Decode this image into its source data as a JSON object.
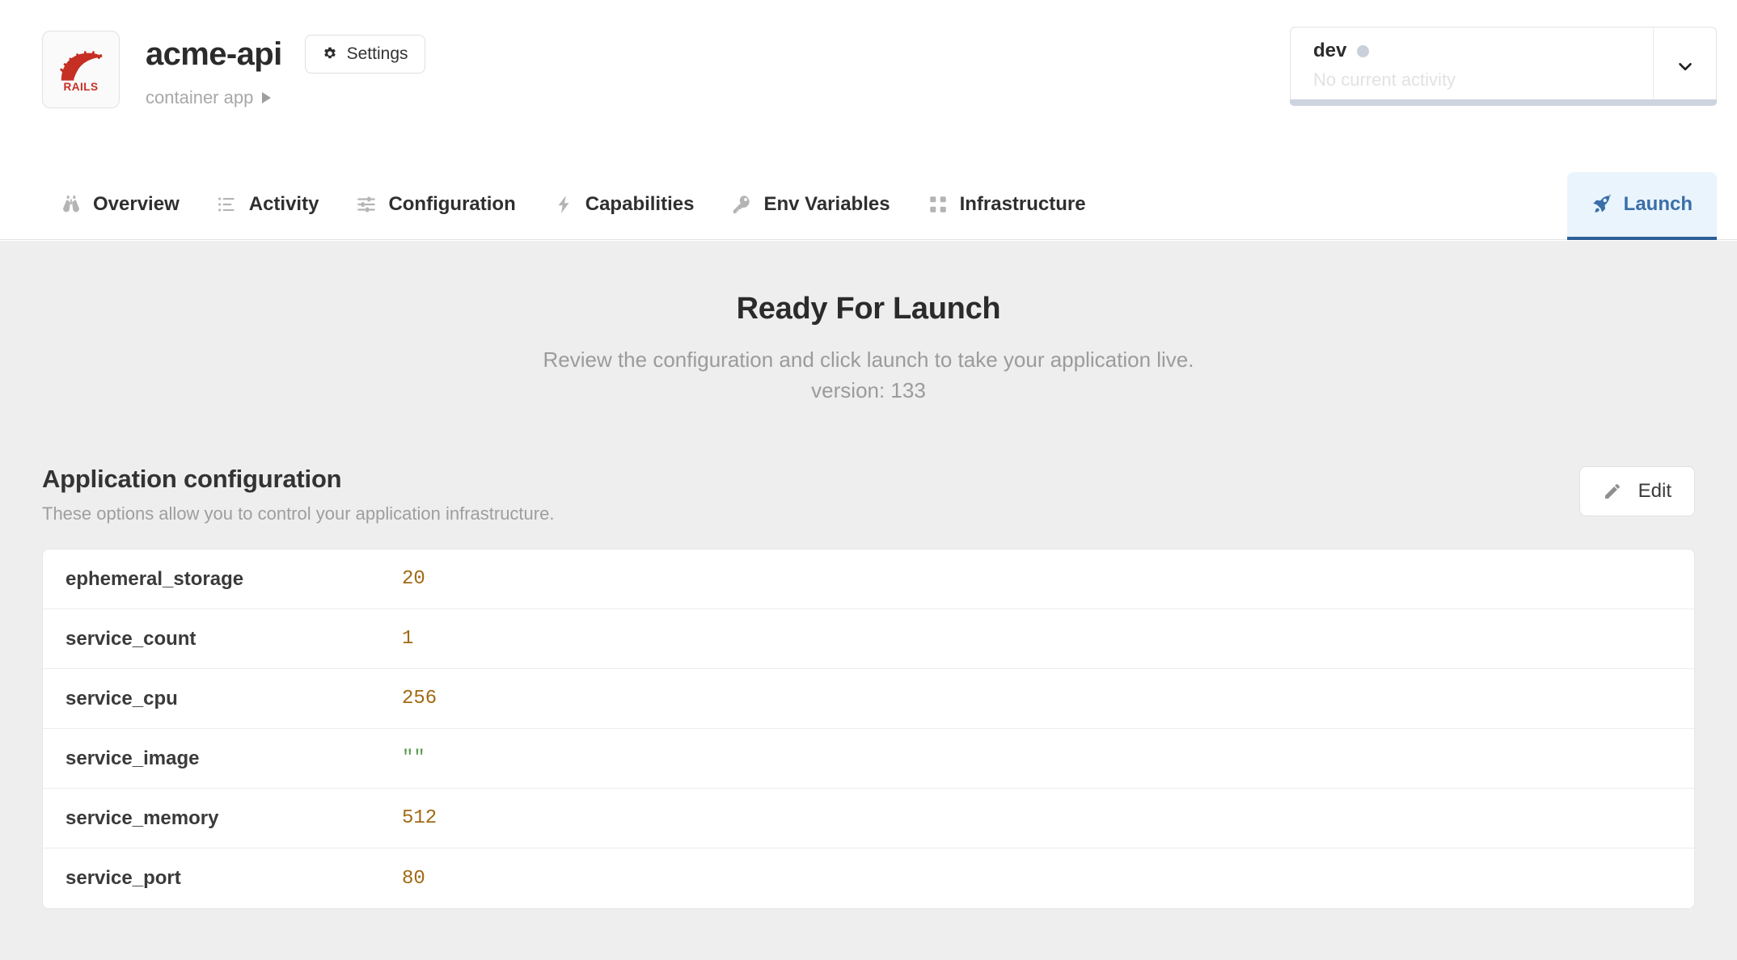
{
  "header": {
    "logo_icon": "rails-logo-icon",
    "app_title": "acme-api",
    "settings_label": "Settings",
    "settings_icon": "gear-icon",
    "breadcrumb_label": "container app",
    "breadcrumb_icon": "caret-right-icon"
  },
  "env_selector": {
    "name": "dev",
    "status_icon": "status-dot-icon",
    "status_color": "#c9d0da",
    "activity": "No current activity",
    "caret_icon": "chevron-down-icon"
  },
  "tabs": [
    {
      "label": "Overview",
      "icon": "binoculars-icon",
      "active": false
    },
    {
      "label": "Activity",
      "icon": "list-icon",
      "active": false
    },
    {
      "label": "Configuration",
      "icon": "sliders-icon",
      "active": false
    },
    {
      "label": "Capabilities",
      "icon": "lightning-icon",
      "active": false
    },
    {
      "label": "Env Variables",
      "icon": "key-icon",
      "active": false
    },
    {
      "label": "Infrastructure",
      "icon": "grid-icon",
      "active": false
    },
    {
      "label": "Launch",
      "icon": "rocket-icon",
      "active": true
    }
  ],
  "hero": {
    "title": "Ready For Launch",
    "subtitle": "Review the configuration and click launch to take your application live.",
    "version": "version: 133"
  },
  "section": {
    "title": "Application configuration",
    "description": "These options allow you to control your application infrastructure.",
    "edit_label": "Edit",
    "edit_icon": "pencil-icon"
  },
  "config_rows": [
    {
      "key": "ephemeral_storage",
      "value": "20",
      "kind": "num"
    },
    {
      "key": "service_count",
      "value": "1",
      "kind": "num"
    },
    {
      "key": "service_cpu",
      "value": "256",
      "kind": "num"
    },
    {
      "key": "service_image",
      "value": "\"\"",
      "kind": "str"
    },
    {
      "key": "service_memory",
      "value": "512",
      "kind": "num"
    },
    {
      "key": "service_port",
      "value": "80",
      "kind": "num"
    }
  ],
  "colors": {
    "accent_blue": "#2d5f99",
    "active_tab_bg": "#e9f4fd",
    "number_value": "#a06a14",
    "string_value": "#5b9a52",
    "page_bg": "#eeeeee",
    "rails_red": "#c52f24"
  }
}
